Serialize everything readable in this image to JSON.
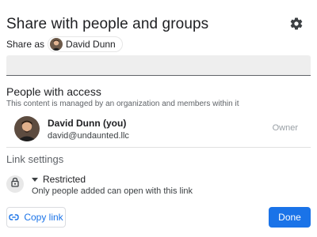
{
  "dialog": {
    "title": "Share with people and groups",
    "settings_icon": "gear-icon"
  },
  "share_as": {
    "label": "Share as",
    "name": "David Dunn"
  },
  "add_people": {
    "placeholder": "",
    "value": ""
  },
  "people_access": {
    "title": "People with access",
    "note": "This content is managed by an organization and members within it",
    "people": [
      {
        "name": "David Dunn (you)",
        "email": "david@undaunted.llc",
        "role": "Owner"
      }
    ]
  },
  "link_settings": {
    "title": "Link settings",
    "mode": "Restricted",
    "description": "Only people added can open with this link",
    "lock_icon": "lock-icon",
    "dropdown_icon": "caret-down-icon"
  },
  "actions": {
    "copy_link": "Copy link",
    "done": "Done"
  },
  "colors": {
    "accent": "#1a73e8",
    "muted": "#5f6368",
    "role": "#9aa0a6"
  }
}
